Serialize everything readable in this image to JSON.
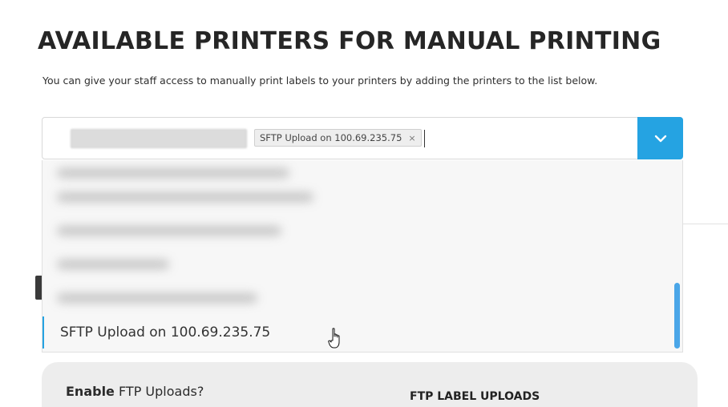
{
  "header": {
    "title": "AVAILABLE PRINTERS FOR MANUAL PRINTING",
    "subtitle": "You can give your staff access to manually print labels to your printers by adding the printers to the list below."
  },
  "printer_select": {
    "selected_chips": [
      {
        "label": "",
        "redacted": true
      },
      {
        "label": "SFTP Upload on 100.69.235.75",
        "remove_glyph": "×"
      }
    ],
    "dropdown_icon": "chevron-down-icon",
    "options": [
      {
        "label": "",
        "redacted": true
      },
      {
        "label": "",
        "redacted": true
      },
      {
        "label": "",
        "redacted": true
      },
      {
        "label": "",
        "redacted": true
      },
      {
        "label": "",
        "redacted": true
      },
      {
        "label": "SFTP Upload on 100.69.235.75",
        "highlighted": true
      }
    ]
  },
  "ftp_panel": {
    "enable_bold": "Enable",
    "enable_rest": " FTP Uploads?",
    "heading": "FTP LABEL UPLOADS"
  },
  "colors": {
    "accent": "#25a3e2",
    "scrollbar": "#4aa6e8",
    "panel_bg": "#ededed"
  }
}
